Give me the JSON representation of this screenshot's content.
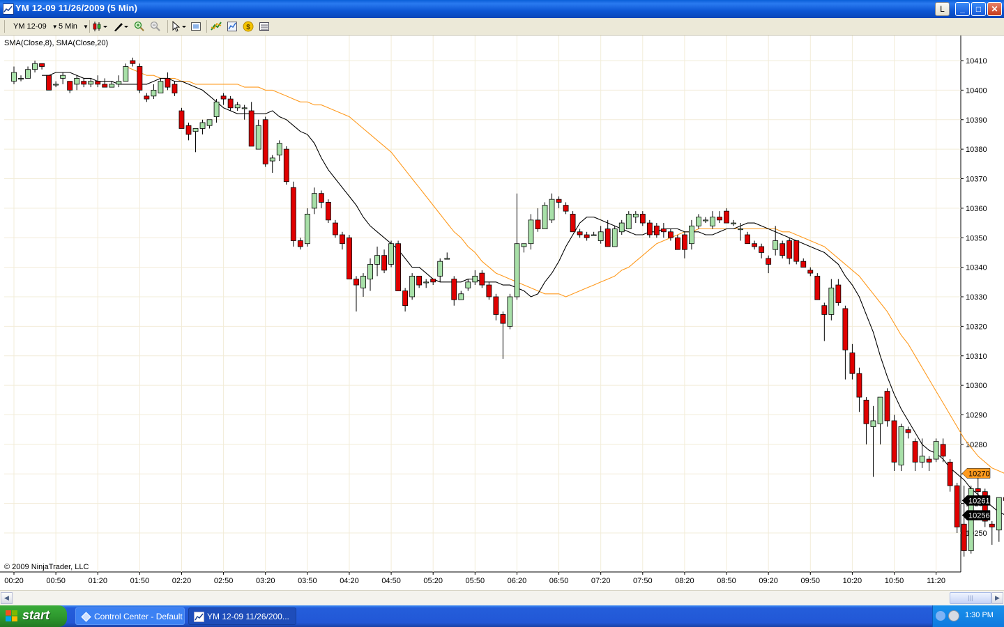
{
  "window": {
    "title": "YM 12-09  11/26/2009 (5 Min)",
    "controls": {
      "l": "L",
      "minimize": "_",
      "maximize": "□",
      "close": "✕"
    }
  },
  "toolbar": {
    "instrument": "YM 12-09",
    "interval": "5 Min",
    "icons": [
      "candlestick-icon",
      "pencil-icon",
      "zoom-in-icon",
      "zoom-out-icon",
      "cursor-icon",
      "properties-icon",
      "indicator-icon",
      "strategy-icon",
      "dollar-icon",
      "data-box-icon"
    ]
  },
  "chart_data": {
    "type": "candlestick",
    "indicators_label": "SMA(Close,8), SMA(Close,20)",
    "copyright": "© 2009 NinjaTrader, LLC",
    "ylim": [
      10243,
      10420
    ],
    "yticks": [
      10250,
      10260,
      10270,
      10280,
      10290,
      10300,
      10310,
      10320,
      10330,
      10340,
      10350,
      10360,
      10370,
      10380,
      10390,
      10400,
      10410
    ],
    "xticks": [
      "00:20",
      "00:50",
      "01:20",
      "01:50",
      "02:20",
      "02:50",
      "03:20",
      "03:50",
      "04:20",
      "04:50",
      "05:20",
      "05:50",
      "06:20",
      "06:50",
      "07:20",
      "07:50",
      "08:20",
      "08:50",
      "09:20",
      "09:50",
      "10:20",
      "10:50",
      "11:20"
    ],
    "grid": true,
    "up_color": "#a8e0a8",
    "down_color": "#e00000",
    "sma8_color": "#000000",
    "sma20_color": "#ff9a1e",
    "price_markers": [
      {
        "label": "10270",
        "value": 10270.2,
        "color": "#ff9a1e"
      },
      {
        "label": "10261",
        "value": 10261,
        "color": "#000000"
      },
      {
        "label": "10256",
        "value": 10256,
        "color": "#000000"
      }
    ],
    "candles": [
      [
        10403,
        10408,
        10402,
        10406
      ],
      [
        10404,
        10405,
        10403,
        10404
      ],
      [
        10404,
        10408,
        10404,
        10407
      ],
      [
        10407,
        10410,
        10406,
        10409
      ],
      [
        10409,
        10409,
        10407,
        10408
      ],
      [
        10405,
        10405,
        10400,
        10400
      ],
      [
        10402,
        10403,
        10401,
        10402
      ],
      [
        10404,
        10406,
        10402,
        10405
      ],
      [
        10403,
        10403,
        10399,
        10400
      ],
      [
        10402,
        10405,
        10400,
        10404
      ],
      [
        10403,
        10404,
        10401,
        10402
      ],
      [
        10402,
        10404,
        10401,
        10403
      ],
      [
        10403,
        10405,
        10401,
        10402
      ],
      [
        10402,
        10404,
        10401,
        10401
      ],
      [
        10401,
        10403,
        10401,
        10402
      ],
      [
        10402,
        10405,
        10401,
        10403
      ],
      [
        10403,
        10409,
        10403,
        10408
      ],
      [
        10410,
        10411,
        10408,
        10409
      ],
      [
        10408,
        10409,
        10399,
        10400
      ],
      [
        10398,
        10399,
        10396,
        10397
      ],
      [
        10398,
        10402,
        10397,
        10400
      ],
      [
        10399,
        10404,
        10399,
        10403
      ],
      [
        10404,
        10406,
        10400,
        10401
      ],
      [
        10402,
        10403,
        10398,
        10399
      ],
      [
        10393,
        10394,
        10387,
        10387
      ],
      [
        10388,
        10389,
        10383,
        10385
      ],
      [
        10386,
        10387,
        10379,
        10387
      ],
      [
        10387,
        10390,
        10385,
        10389
      ],
      [
        10388,
        10390,
        10387,
        10390
      ],
      [
        10391,
        10397,
        10389,
        10396
      ],
      [
        10398,
        10399,
        10395,
        10397
      ],
      [
        10397,
        10398,
        10393,
        10394
      ],
      [
        10394,
        10396,
        10393,
        10395
      ],
      [
        10394,
        10395,
        10390,
        10394
      ],
      [
        10393,
        10396,
        10381,
        10381
      ],
      [
        10380,
        10390,
        10380,
        10388
      ],
      [
        10390,
        10391,
        10374,
        10375
      ],
      [
        10376,
        10378,
        10372,
        10377
      ],
      [
        10378,
        10383,
        10376,
        10382
      ],
      [
        10380,
        10381,
        10368,
        10369
      ],
      [
        10367,
        10369,
        10347,
        10349
      ],
      [
        10349,
        10350,
        10346,
        10347
      ],
      [
        10348,
        10360,
        10347,
        10358
      ],
      [
        10360,
        10367,
        10358,
        10365
      ],
      [
        10365,
        10366,
        10360,
        10362
      ],
      [
        10362,
        10363,
        10355,
        10356
      ],
      [
        10355,
        10356,
        10350,
        10351
      ],
      [
        10351,
        10352,
        10346,
        10348
      ],
      [
        10350,
        10351,
        10336,
        10336
      ],
      [
        10336,
        10337,
        10325,
        10334
      ],
      [
        10333,
        10338,
        10330,
        10337
      ],
      [
        10336,
        10343,
        10332,
        10341
      ],
      [
        10341,
        10347,
        10337,
        10344
      ],
      [
        10344,
        10346,
        10338,
        10339
      ],
      [
        10341,
        10349,
        10340,
        10348
      ],
      [
        10348,
        10349,
        10332,
        10332
      ],
      [
        10332,
        10333,
        10325,
        10327
      ],
      [
        10330,
        10338,
        10329,
        10337
      ],
      [
        10337,
        10337,
        10333,
        10334
      ],
      [
        10335,
        10336,
        10333,
        10335
      ],
      [
        10336,
        10336,
        10334,
        10335
      ],
      [
        10337,
        10343,
        10335,
        10342
      ],
      [
        10343,
        10345,
        10343,
        10343
      ],
      [
        10336,
        10337,
        10327,
        10329
      ],
      [
        10329,
        10332,
        10329,
        10331
      ],
      [
        10333,
        10336,
        10332,
        10335
      ],
      [
        10335,
        10339,
        10334,
        10337
      ],
      [
        10338,
        10339,
        10333,
        10334
      ],
      [
        10334,
        10335,
        10329,
        10330
      ],
      [
        10330,
        10331,
        10322,
        10324
      ],
      [
        10324,
        10325,
        10309,
        10321
      ],
      [
        10320,
        10331,
        10319,
        10330
      ],
      [
        10330,
        10365,
        10329,
        10348
      ],
      [
        10347,
        10348,
        10345,
        10348
      ],
      [
        10348,
        10358,
        10346,
        10356
      ],
      [
        10356,
        10360,
        10352,
        10353
      ],
      [
        10353,
        10362,
        10353,
        10361
      ],
      [
        10356,
        10365,
        10355,
        10363
      ],
      [
        10363,
        10364,
        10360,
        10362
      ],
      [
        10361,
        10362,
        10358,
        10359
      ],
      [
        10358,
        10359,
        10352,
        10352
      ],
      [
        10352,
        10353,
        10350,
        10351
      ],
      [
        10351,
        10352,
        10349,
        10350
      ],
      [
        10351,
        10352,
        10351,
        10351
      ],
      [
        10349,
        10354,
        10348,
        10352
      ],
      [
        10353,
        10356,
        10347,
        10347
      ],
      [
        10347,
        10354,
        10347,
        10353
      ],
      [
        10352,
        10356,
        10351,
        10355
      ],
      [
        10353,
        10359,
        10353,
        10358
      ],
      [
        10357,
        10359,
        10355,
        10358
      ],
      [
        10358,
        10359,
        10354,
        10355
      ],
      [
        10355,
        10356,
        10350,
        10351
      ],
      [
        10354,
        10355,
        10350,
        10351
      ],
      [
        10353,
        10355,
        10350,
        10352
      ],
      [
        10352,
        10353,
        10349,
        10350
      ],
      [
        10350,
        10351,
        10346,
        10346
      ],
      [
        10351,
        10352,
        10343,
        10346
      ],
      [
        10348,
        10356,
        10346,
        10354
      ],
      [
        10354,
        10358,
        10353,
        10357
      ],
      [
        10356,
        10357,
        10355,
        10356
      ],
      [
        10354,
        10359,
        10353,
        10357
      ],
      [
        10357,
        10359,
        10355,
        10356
      ],
      [
        10359,
        10360,
        10355,
        10355
      ],
      [
        10355,
        10356,
        10354,
        10355
      ],
      [
        10353,
        10355,
        10349,
        10353
      ],
      [
        10351,
        10352,
        10348,
        10348
      ],
      [
        10348,
        10349,
        10346,
        10347
      ],
      [
        10347,
        10348,
        10343,
        10345
      ],
      [
        10343,
        10344,
        10338,
        10341
      ],
      [
        10346,
        10354,
        10344,
        10349
      ],
      [
        10348,
        10349,
        10343,
        10344
      ],
      [
        10349,
        10350,
        10341,
        10343
      ],
      [
        10349,
        10349,
        10341,
        10342
      ],
      [
        10342,
        10343,
        10340,
        10340
      ],
      [
        10339,
        10340,
        10337,
        10338
      ],
      [
        10337,
        10338,
        10329,
        10329
      ],
      [
        10327,
        10328,
        10315,
        10324
      ],
      [
        10324,
        10336,
        10322,
        10333
      ],
      [
        10334,
        10336,
        10327,
        10328
      ],
      [
        10326,
        10327,
        10302,
        10312
      ],
      [
        10311,
        10314,
        10302,
        10304
      ],
      [
        10304,
        10306,
        10291,
        10296
      ],
      [
        10295,
        10296,
        10280,
        10287
      ],
      [
        10286,
        10293,
        10269,
        10288
      ],
      [
        10287,
        10296,
        10280,
        10296
      ],
      [
        10298,
        10299,
        10286,
        10288
      ],
      [
        10288,
        10290,
        10271,
        10274
      ],
      [
        10273,
        10287,
        10271,
        10286
      ],
      [
        10285,
        10286,
        10282,
        10284
      ],
      [
        10281,
        10282,
        10271,
        10274
      ],
      [
        10274,
        10282,
        10272,
        10276
      ],
      [
        10275,
        10276,
        10271,
        10274
      ],
      [
        10275,
        10282,
        10274,
        10281
      ],
      [
        10280,
        10282,
        10274,
        10276
      ],
      [
        10274,
        10275,
        10264,
        10266
      ],
      [
        10266,
        10267,
        10250,
        10252
      ],
      [
        10253,
        10266,
        10242,
        10244
      ],
      [
        10244,
        10266,
        10243,
        10265
      ],
      [
        10265,
        10271,
        10262,
        10264
      ],
      [
        10264,
        10265,
        10252,
        10254
      ],
      [
        10253,
        10254,
        10246,
        10252
      ],
      [
        10251,
        10262,
        10247,
        10262
      ],
      [
        10262,
        10268,
        10261,
        10261
      ]
    ],
    "sma8": [
      10405,
      10405,
      10406,
      10406,
      10406,
      10405,
      10404,
      10404,
      10403,
      10403,
      10403,
      10402,
      10402,
      10402,
      10402,
      10402,
      10403,
      10404,
      10404,
      10403,
      10403,
      10402,
      10401,
      10400,
      10398,
      10396,
      10394,
      10393,
      10392,
      10392,
      10392,
      10392,
      10392,
      10393,
      10391,
      10390,
      10388,
      10386,
      10385,
      10382,
      10377,
      10373,
      10370,
      10367,
      10364,
      10361,
      10357,
      10354,
      10352,
      10350,
      10348,
      10346,
      10343,
      10340,
      10340,
      10338,
      10336,
      10335,
      10335,
      10335,
      10335,
      10336,
      10336,
      10335,
      10335,
      10335,
      10334,
      10334,
      10333,
      10332,
      10330,
      10331,
      10335,
      10338,
      10342,
      10347,
      10351,
      10355,
      10357,
      10357,
      10356,
      10355,
      10354,
      10353,
      10352,
      10351,
      10351,
      10352,
      10352,
      10353,
      10353,
      10353,
      10352,
      10352,
      10352,
      10351,
      10351,
      10352,
      10353,
      10353,
      10354,
      10355,
      10355,
      10354,
      10353,
      10352,
      10351,
      10350,
      10349,
      10348,
      10347,
      10346,
      10345,
      10343,
      10341,
      10337,
      10334,
      10330,
      10324,
      10318,
      10310,
      10303,
      10297,
      10292,
      10288,
      10284,
      10280,
      10278,
      10277,
      10275,
      10272,
      10270,
      10268,
      10265,
      10263,
      10261,
      10259,
      10257,
      10256
    ],
    "sma20": [
      10408,
      10407,
      10406,
      10405,
      10405,
      10404,
      10404,
      10404,
      10403,
      10403,
      10402,
      10402,
      10402,
      10402,
      10402,
      10402,
      10402,
      10401,
      10401,
      10401,
      10400,
      10400,
      10399,
      10398,
      10397,
      10396,
      10396,
      10395,
      10395,
      10394,
      10393,
      10392,
      10391,
      10389,
      10387,
      10385,
      10383,
      10381,
      10379,
      10376,
      10373,
      10370,
      10367,
      10364,
      10361,
      10358,
      10355,
      10352,
      10350,
      10347,
      10345,
      10342,
      10340,
      10338,
      10337,
      10336,
      10335,
      10334,
      10333,
      10332,
      10331,
      10331,
      10331,
      10330,
      10331,
      10332,
      10333,
      10334,
      10335,
      10336,
      10337,
      10339,
      10340,
      10342,
      10344,
      10346,
      10348,
      10349,
      10350,
      10351,
      10352,
      10352,
      10353,
      10353,
      10353,
      10353,
      10353,
      10353,
      10353,
      10353,
      10353,
      10353,
      10353,
      10353,
      10352,
      10352,
      10351,
      10350,
      10349,
      10348,
      10347,
      10345,
      10343,
      10341,
      10339,
      10337,
      10334,
      10331,
      10328,
      10325,
      10321,
      10317,
      10314,
      10310,
      10306,
      10302,
      10298,
      10294,
      10290,
      10286,
      10282,
      10279,
      10276,
      10274,
      10272,
      10271,
      10270
    ]
  }
}
